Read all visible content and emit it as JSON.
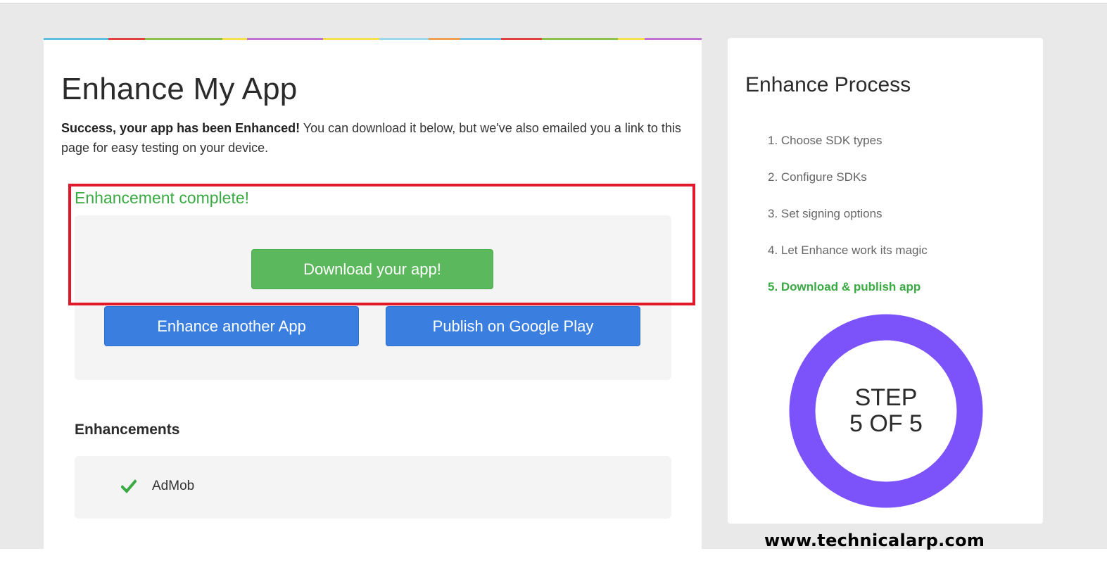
{
  "main": {
    "title": "Enhance My App",
    "intro_bold": "Success, your app has been Enhanced!",
    "intro_text": " You can download it below, but we've also emailed you a link to this page for easy testing on your device.",
    "complete_label": "Enhancement complete!",
    "download_button": "Download your app!",
    "enhance_another_button": "Enhance another App",
    "publish_button": "Publish on Google Play",
    "enhancements_heading": "Enhancements",
    "enhancements": [
      {
        "label": "AdMob",
        "icon": "check-icon"
      }
    ],
    "strip_colors": [
      "#5bc0de",
      "#e04040",
      "#8bc34a",
      "#f5e24a",
      "#c070d0",
      "#f5e24a",
      "#9ad8f0",
      "#f0a050",
      "#e04040",
      "#8bc34a",
      "#f5e24a",
      "#c070d0"
    ]
  },
  "side": {
    "title": "Enhance Process",
    "steps": [
      "1. Choose SDK types",
      "2. Configure SDKs",
      "3. Set signing options",
      "4. Let Enhance work its magic",
      "5. Download & publish app"
    ],
    "active_step": 5,
    "ring_line1": "STEP",
    "ring_line2": "5 OF 5",
    "progress": 1.0
  },
  "watermark": "www.technicalarp.com",
  "colors": {
    "green": "#5cb85c",
    "blue": "#3a7fe0",
    "ring": "#7c52fb",
    "highlight": "#e0182a"
  }
}
